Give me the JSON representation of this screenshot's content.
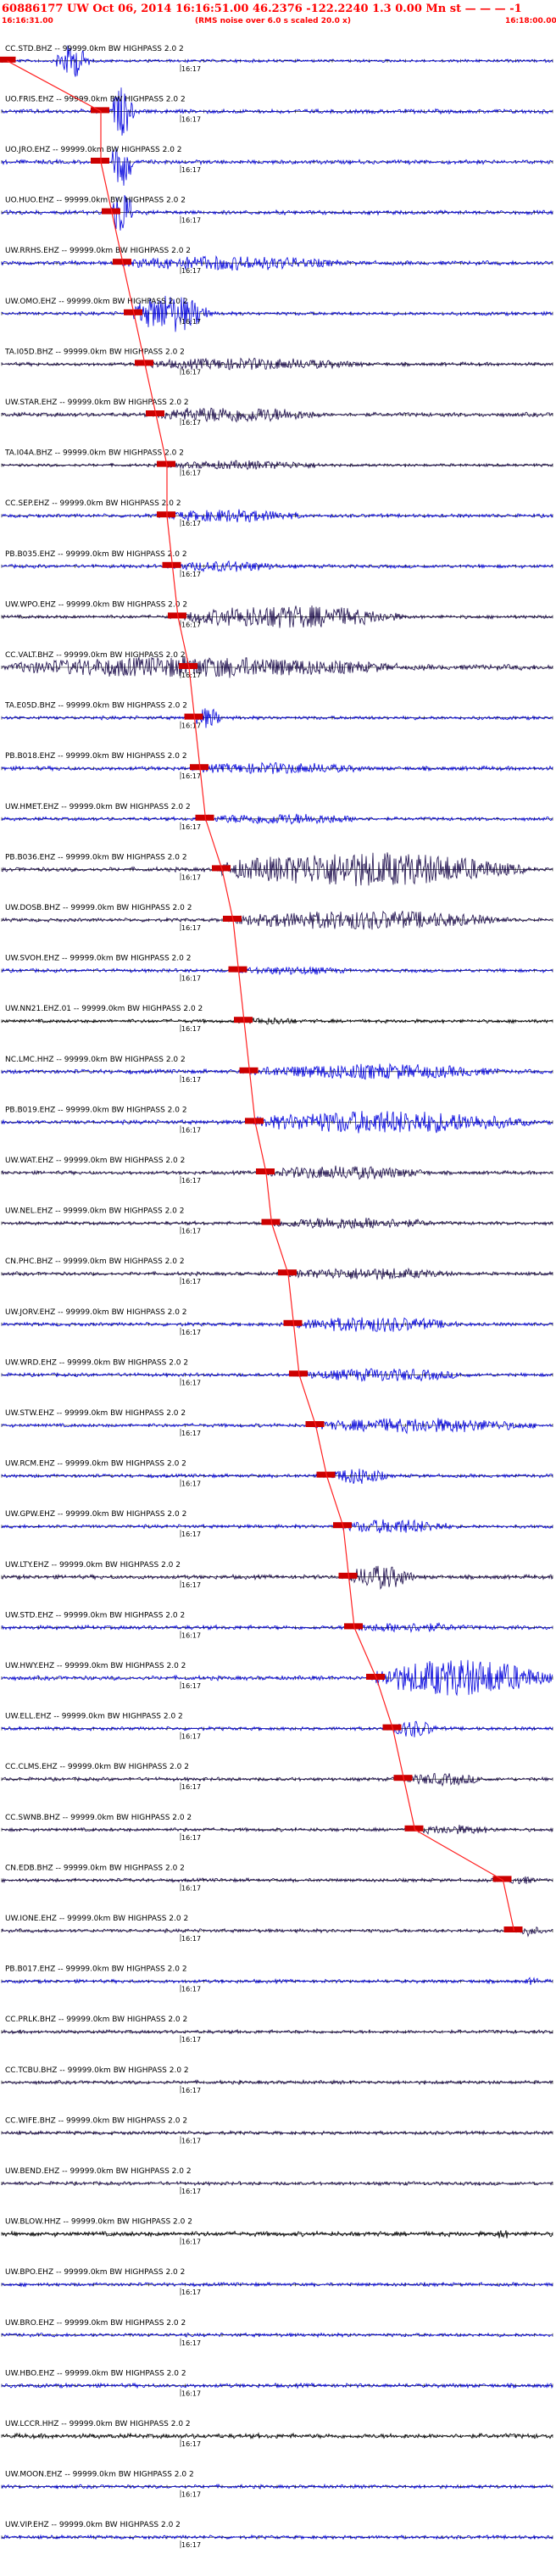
{
  "header": {
    "title": "60886177 UW Oct 06, 2014 16:16:51.00   46.2376 -122.2240  1.3 0.00 Mn st — — — -1",
    "start_time": "16:16:31.00",
    "rms_note": "(RMS noise over 6.0 s scaled 20.0 x)",
    "end_time": "16:18:00.00"
  },
  "colors": {
    "title": "#ff0000",
    "pick_box": "#cc0000",
    "pick_line": "#ff2020",
    "axis": "#000000",
    "blue": "#0000dd",
    "dark": "#1a0a4a",
    "black": "#000000"
  },
  "chart_data": {
    "type": "line",
    "title": "60886177 UW Oct 06, 2014 16:16:51.00   46.2376 -122.2240  1.3 0.00 Mn st — — — -1",
    "xlabel": "",
    "ylabel": "",
    "time_tick_label": "16:17",
    "series": [
      {
        "name": "CC.STD.BHZ -- 99999.0km BW  HIGHPASS  2.0  2",
        "color": "blue",
        "amplitude": 0.25,
        "burst_start": 0.1,
        "burst_amp": 3.5,
        "burst_len": 0.06,
        "pick_frac": 0.01
      },
      {
        "name": "UO.FRIS.EHZ -- 99999.0km BW  HIGHPASS  2.0  2",
        "color": "blue",
        "amplitude": 0.35,
        "burst_start": 0.2,
        "burst_amp": 5.0,
        "burst_len": 0.04,
        "pick_frac": 0.18
      },
      {
        "name": "UO.JRO.EHZ -- 99999.0km BW  HIGHPASS  2.0  2",
        "color": "blue",
        "amplitude": 0.35,
        "burst_start": 0.2,
        "burst_amp": 5.0,
        "burst_len": 0.04,
        "pick_frac": 0.18
      },
      {
        "name": "UO.HUO.EHZ -- 99999.0km BW  HIGHPASS  2.0  2",
        "color": "blue",
        "amplitude": 0.35,
        "burst_start": 0.2,
        "burst_amp": 5.0,
        "burst_len": 0.04,
        "pick_frac": 0.2
      },
      {
        "name": "UW.RRHS.EHZ -- 99999.0km BW  HIGHPASS  2.0  2",
        "color": "blue",
        "amplitude": 0.35,
        "burst_start": 0.22,
        "burst_amp": 1.2,
        "burst_len": 0.4,
        "pick_frac": 0.22
      },
      {
        "name": "UW.OMO.EHZ -- 99999.0km BW  HIGHPASS  2.0  2",
        "color": "blue",
        "amplitude": 0.3,
        "burst_start": 0.24,
        "burst_amp": 4.0,
        "burst_len": 0.14,
        "pick_frac": 0.24
      },
      {
        "name": "TA.I05D.BHZ -- 99999.0km BW  HIGHPASS  2.0  2",
        "color": "dark",
        "amplitude": 0.3,
        "burst_start": 0.26,
        "burst_amp": 1.0,
        "burst_len": 0.4,
        "pick_frac": 0.26
      },
      {
        "name": "UW.STAR.EHZ -- 99999.0km BW  HIGHPASS  2.0  2",
        "color": "dark",
        "amplitude": 0.35,
        "burst_start": 0.28,
        "burst_amp": 1.4,
        "burst_len": 0.3,
        "pick_frac": 0.28
      },
      {
        "name": "TA.I04A.BHZ -- 99999.0km BW  HIGHPASS  2.0  2",
        "color": "dark",
        "amplitude": 0.25,
        "burst_start": 0.3,
        "burst_amp": 0.7,
        "burst_len": 0.3,
        "pick_frac": 0.3
      },
      {
        "name": "CC.SEP.EHZ -- 99999.0km BW  HIGHPASS  2.0  2",
        "color": "blue",
        "amplitude": 0.3,
        "burst_start": 0.3,
        "burst_amp": 1.1,
        "burst_len": 0.25,
        "pick_frac": 0.3
      },
      {
        "name": "PB.B035.EHZ -- 99999.0km BW  HIGHPASS  2.0  2",
        "color": "blue",
        "amplitude": 0.3,
        "burst_start": 0.31,
        "burst_amp": 0.9,
        "burst_len": 0.2,
        "pick_frac": 0.31
      },
      {
        "name": "UW.WPO.EHZ -- 99999.0km BW  HIGHPASS  2.0  2",
        "color": "dark",
        "amplitude": 0.3,
        "burst_start": 0.33,
        "burst_amp": 2.2,
        "burst_len": 0.4,
        "pick_frac": 0.32
      },
      {
        "name": "CC.VALT.BHZ -- 99999.0km BW  HIGHPASS  2.0  2",
        "color": "dark",
        "amplitude": 0.45,
        "burst_start": 0.02,
        "burst_amp": 1.8,
        "burst_len": 0.7,
        "pick_frac": 0.34
      },
      {
        "name": "TA.E05D.BHZ -- 99999.0km BW  HIGHPASS  2.0  2",
        "color": "blue",
        "amplitude": 0.3,
        "burst_start": 0.35,
        "burst_amp": 2.0,
        "burst_len": 0.05,
        "pick_frac": 0.35
      },
      {
        "name": "PB.B018.EHZ -- 99999.0km BW  HIGHPASS  2.0  2",
        "color": "blue",
        "amplitude": 0.35,
        "burst_start": 0.36,
        "burst_amp": 0.9,
        "burst_len": 0.3,
        "pick_frac": 0.36
      },
      {
        "name": "UW.HMET.EHZ -- 99999.0km BW  HIGHPASS  2.0  2",
        "color": "blue",
        "amplitude": 0.3,
        "burst_start": 0.37,
        "burst_amp": 0.9,
        "burst_len": 0.3,
        "pick_frac": 0.37
      },
      {
        "name": "PB.B036.EHZ -- 99999.0km BW  HIGHPASS  2.0  2",
        "color": "dark",
        "amplitude": 0.35,
        "burst_start": 0.4,
        "burst_amp": 3.5,
        "burst_len": 0.55,
        "pick_frac": 0.4
      },
      {
        "name": "UW.DOSB.BHZ -- 99999.0km BW  HIGHPASS  2.0  2",
        "color": "dark",
        "amplitude": 0.3,
        "burst_start": 0.42,
        "burst_amp": 1.8,
        "burst_len": 0.5,
        "pick_frac": 0.42
      },
      {
        "name": "UW.SVOH.EHZ -- 99999.0km BW  HIGHPASS  2.0  2",
        "color": "blue",
        "amplitude": 0.3,
        "burst_start": 0.43,
        "burst_amp": 0.6,
        "burst_len": 0.2,
        "pick_frac": 0.43
      },
      {
        "name": "UW.NN21.EHZ.01 -- 99999.0km BW  HIGHPASS  2.0  2",
        "color": "black",
        "amplitude": 0.3,
        "burst_start": 0.44,
        "burst_amp": 0.5,
        "burst_len": 0.1,
        "pick_frac": 0.44
      },
      {
        "name": "NC.LMC.HHZ -- 99999.0km BW  HIGHPASS  2.0  2",
        "color": "blue",
        "amplitude": 0.35,
        "burst_start": 0.46,
        "burst_amp": 1.3,
        "burst_len": 0.45,
        "pick_frac": 0.45
      },
      {
        "name": "PB.B019.EHZ -- 99999.0km BW  HIGHPASS  2.0  2",
        "color": "blue",
        "amplitude": 0.35,
        "burst_start": 0.46,
        "burst_amp": 2.2,
        "burst_len": 0.5,
        "pick_frac": 0.46
      },
      {
        "name": "UW.WAT.EHZ -- 99999.0km BW  HIGHPASS  2.0  2",
        "color": "dark",
        "amplitude": 0.3,
        "burst_start": 0.48,
        "burst_amp": 1.2,
        "burst_len": 0.3,
        "pick_frac": 0.48
      },
      {
        "name": "UW.NEL.EHZ -- 99999.0km BW  HIGHPASS  2.0  2",
        "color": "dark",
        "amplitude": 0.3,
        "burst_start": 0.49,
        "burst_amp": 1.0,
        "burst_len": 0.3,
        "pick_frac": 0.49
      },
      {
        "name": "CN.PHC.BHZ -- 99999.0km BW  HIGHPASS  2.0  2",
        "color": "dark",
        "amplitude": 0.3,
        "burst_start": 0.52,
        "burst_amp": 1.0,
        "burst_len": 0.3,
        "pick_frac": 0.52
      },
      {
        "name": "UW.JORV.EHZ -- 99999.0km BW  HIGHPASS  2.0  2",
        "color": "blue",
        "amplitude": 0.3,
        "burst_start": 0.53,
        "burst_amp": 1.4,
        "burst_len": 0.3,
        "pick_frac": 0.53
      },
      {
        "name": "UW.WRD.EHZ -- 99999.0km BW  HIGHPASS  2.0  2",
        "color": "blue",
        "amplitude": 0.3,
        "burst_start": 0.55,
        "burst_amp": 1.1,
        "burst_len": 0.3,
        "pick_frac": 0.54
      },
      {
        "name": "UW.STW.EHZ -- 99999.0km BW  HIGHPASS  2.0  2",
        "color": "blue",
        "amplitude": 0.3,
        "burst_start": 0.57,
        "burst_amp": 1.3,
        "burst_len": 0.4,
        "pick_frac": 0.57
      },
      {
        "name": "UW.RCM.EHZ -- 99999.0km BW  HIGHPASS  2.0  2",
        "color": "blue",
        "amplitude": 0.3,
        "burst_start": 0.6,
        "burst_amp": 1.6,
        "burst_len": 0.1,
        "pick_frac": 0.59
      },
      {
        "name": "UW.GPW.EHZ -- 99999.0km BW  HIGHPASS  2.0  2",
        "color": "blue",
        "amplitude": 0.3,
        "burst_start": 0.62,
        "burst_amp": 1.3,
        "burst_len": 0.2,
        "pick_frac": 0.62
      },
      {
        "name": "UW.LTY.EHZ -- 99999.0km BW  HIGHPASS  2.0  2",
        "color": "dark",
        "amplitude": 0.35,
        "burst_start": 0.63,
        "burst_amp": 2.3,
        "burst_len": 0.12,
        "pick_frac": 0.63
      },
      {
        "name": "UW.STD.EHZ -- 99999.0km BW  HIGHPASS  2.0  2",
        "color": "blue",
        "amplitude": 0.35,
        "burst_start": 0.64,
        "burst_amp": 0.7,
        "burst_len": 0.2,
        "pick_frac": 0.64
      },
      {
        "name": "UW.HWY.EHZ -- 99999.0km BW  HIGHPASS  2.0  2",
        "color": "blue",
        "amplitude": 0.35,
        "burst_start": 0.68,
        "burst_amp": 3.8,
        "burst_len": 0.32,
        "pick_frac": 0.68
      },
      {
        "name": "UW.ELL.EHZ -- 99999.0km BW  HIGHPASS  2.0  2",
        "color": "blue",
        "amplitude": 0.3,
        "burst_start": 0.71,
        "burst_amp": 1.6,
        "burst_len": 0.08,
        "pick_frac": 0.71
      },
      {
        "name": "CC.CLMS.EHZ -- 99999.0km BW  HIGHPASS  2.0  2",
        "color": "dark",
        "amplitude": 0.3,
        "burst_start": 0.73,
        "burst_amp": 1.0,
        "burst_len": 0.15,
        "pick_frac": 0.73
      },
      {
        "name": "CC.SWNB.BHZ -- 99999.0km BW  HIGHPASS  2.0  2",
        "color": "dark",
        "amplitude": 0.3,
        "burst_start": 0.75,
        "burst_amp": 0.7,
        "burst_len": 0.15,
        "pick_frac": 0.75
      },
      {
        "name": "CN.EDB.BHZ -- 99999.0km BW  HIGHPASS  2.0  2",
        "color": "dark",
        "amplitude": 0.3,
        "burst_start": 0.92,
        "burst_amp": 0.6,
        "burst_len": 0.05,
        "pick_frac": 0.91
      },
      {
        "name": "UW.IONE.EHZ -- 99999.0km BW  HIGHPASS  2.0  2",
        "color": "dark",
        "amplitude": 0.3,
        "burst_start": 0.93,
        "burst_amp": 0.9,
        "burst_len": 0.05,
        "pick_frac": 0.93
      },
      {
        "name": "PB.B017.EHZ -- 99999.0km BW  HIGHPASS  2.0  2",
        "color": "blue",
        "amplitude": 0.3,
        "burst_start": 0.95,
        "burst_amp": 0.5,
        "burst_len": 0.03,
        "pick_frac": null
      },
      {
        "name": "CC.PRLK.BHZ -- 99999.0km BW  HIGHPASS  2.0  2",
        "color": "dark",
        "amplitude": 0.3,
        "burst_start": null,
        "burst_amp": 0,
        "burst_len": 0,
        "pick_frac": null
      },
      {
        "name": "CC.TCBU.BHZ -- 99999.0km BW  HIGHPASS  2.0  2",
        "color": "dark",
        "amplitude": 0.3,
        "burst_start": null,
        "burst_amp": 0,
        "burst_len": 0,
        "pick_frac": null
      },
      {
        "name": "CC.WIFE.BHZ -- 99999.0km BW  HIGHPASS  2.0  2",
        "color": "dark",
        "amplitude": 0.3,
        "burst_start": null,
        "burst_amp": 0,
        "burst_len": 0,
        "pick_frac": null
      },
      {
        "name": "UW.BEND.EHZ -- 99999.0km BW  HIGHPASS  2.0  2",
        "color": "dark",
        "amplitude": 0.3,
        "burst_start": null,
        "burst_amp": 0,
        "burst_len": 0,
        "pick_frac": null
      },
      {
        "name": "UW.BLOW.HHZ -- 99999.0km BW  HIGHPASS  2.0  2",
        "color": "black",
        "amplitude": 0.4,
        "burst_start": 0.9,
        "burst_amp": 0.8,
        "burst_len": 0.02,
        "pick_frac": null
      },
      {
        "name": "UW.BPO.EHZ -- 99999.0km BW  HIGHPASS  2.0  2",
        "color": "blue",
        "amplitude": 0.3,
        "burst_start": null,
        "burst_amp": 0,
        "burst_len": 0,
        "pick_frac": null
      },
      {
        "name": "UW.BRO.EHZ -- 99999.0km BW  HIGHPASS  2.0  2",
        "color": "blue",
        "amplitude": 0.3,
        "burst_start": null,
        "burst_amp": 0,
        "burst_len": 0,
        "pick_frac": null
      },
      {
        "name": "UW.HBO.EHZ -- 99999.0km BW  HIGHPASS  2.0  2",
        "color": "blue",
        "amplitude": 0.35,
        "burst_start": null,
        "burst_amp": 0,
        "burst_len": 0,
        "pick_frac": null
      },
      {
        "name": "UW.LCCR.HHZ -- 99999.0km BW  HIGHPASS  2.0  2",
        "color": "black",
        "amplitude": 0.4,
        "burst_start": null,
        "burst_amp": 0,
        "burst_len": 0,
        "pick_frac": null
      },
      {
        "name": "UW.MOON.EHZ -- 99999.0km BW  HIGHPASS  2.0  2",
        "color": "blue",
        "amplitude": 0.3,
        "burst_start": null,
        "burst_amp": 0,
        "burst_len": 0,
        "pick_frac": null
      },
      {
        "name": "UW.VIP.EHZ -- 99999.0km BW  HIGHPASS  2.0  2",
        "color": "blue",
        "amplitude": 0.3,
        "burst_start": null,
        "burst_amp": 0,
        "burst_len": 0,
        "pick_frac": null
      }
    ]
  }
}
